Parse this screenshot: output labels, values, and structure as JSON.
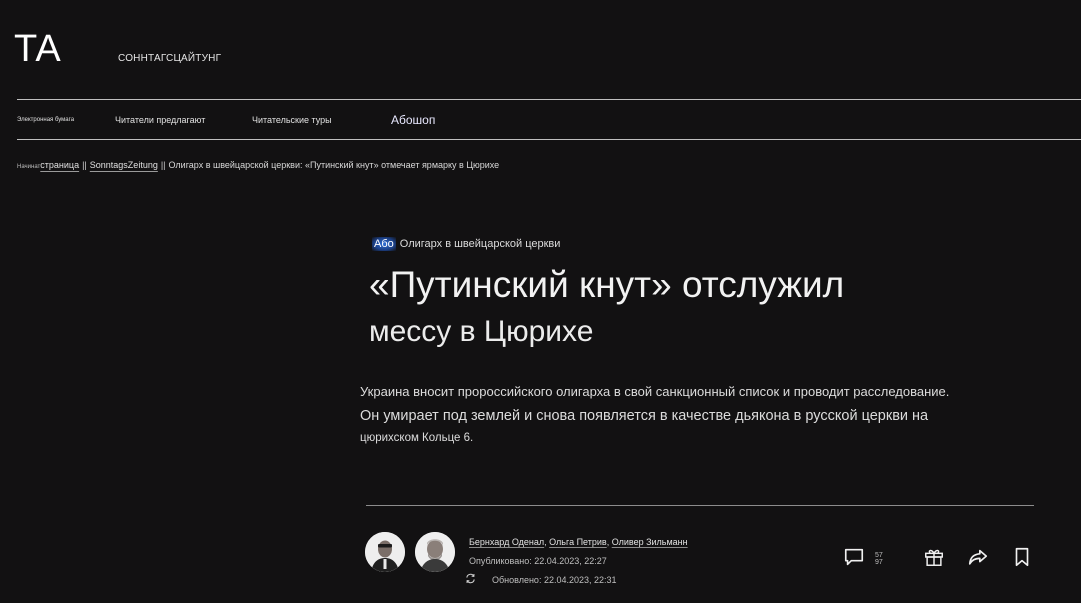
{
  "header": {
    "logo": "TA",
    "brand": "СОННТАГСЦАЙТУНГ"
  },
  "nav": {
    "items": [
      {
        "label": "Электронная бумага"
      },
      {
        "label": "Читатели предлагают"
      },
      {
        "label": "Читательские туры"
      },
      {
        "label": "Абошоп"
      }
    ]
  },
  "breadcrumb": {
    "start": "Начинат",
    "home": "страница",
    "section": "SonntagsZeitung",
    "current": "Олигарх в швейцарской церкви: «Путинский кнут» отмечает ярмарку в Цюрихе"
  },
  "article": {
    "kicker_tag": "Або",
    "kicker": "Олигарх в швейцарской церкви",
    "headline": "«Путинский кнут» отслужил",
    "subheadline": "мессу в Цюрихе",
    "lead_1": "Украина вносит пророссийского олигарха в свой санкционный список и проводит расследование.",
    "lead_2": "Он умирает под землей и снова появляется в качестве дьякона в русской церкви на",
    "lead_3": "цюрихском Кольце 6."
  },
  "meta": {
    "authors": [
      "Бернхард Оденал",
      "Ольга Петрив",
      "Оливер Зильманн"
    ],
    "published": "Опубликовано: 22.04.2023, 22:27",
    "updated": "Обновлено: 22.04.2023, 22:31"
  },
  "actions": {
    "comment_count": "57 97",
    "icons": [
      "comment-icon",
      "gift-icon",
      "share-icon",
      "bookmark-icon"
    ]
  }
}
